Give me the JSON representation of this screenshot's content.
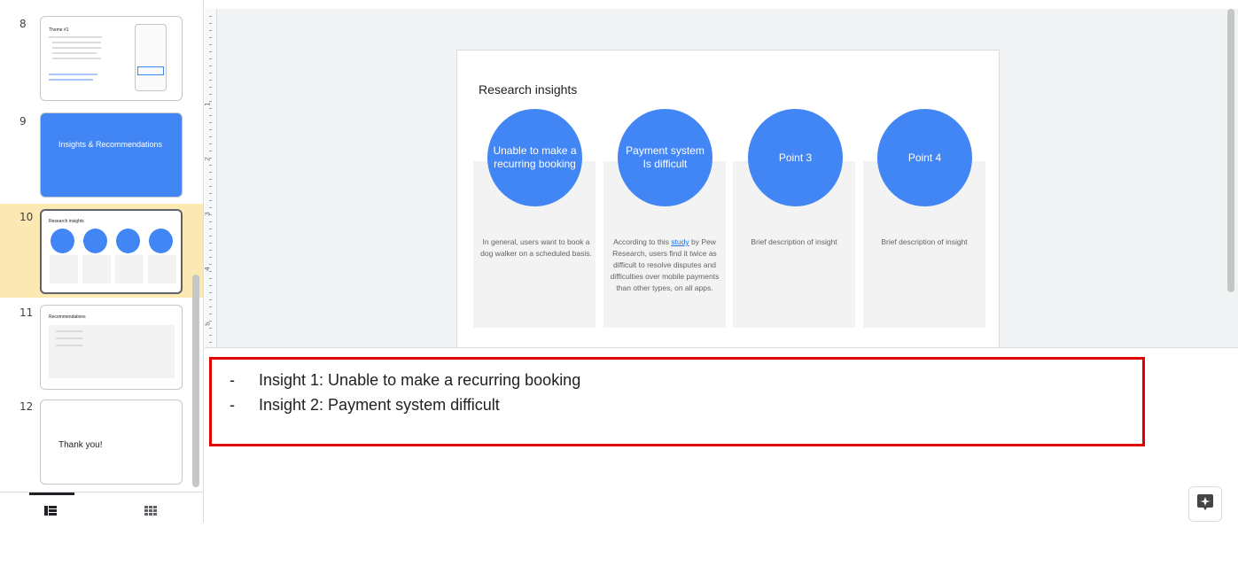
{
  "filmstrip": {
    "slides": [
      {
        "num": "8",
        "title": "Theme #1"
      },
      {
        "num": "9",
        "title": "Insights & Recommendations"
      },
      {
        "num": "10",
        "title": "Research insights"
      },
      {
        "num": "11",
        "title": "Recommendations"
      },
      {
        "num": "12",
        "title": "Thank you!"
      }
    ],
    "selected": "10"
  },
  "view_toggle": {
    "filmstrip_icon": "filmstrip-view-icon",
    "grid_icon": "grid-view-icon"
  },
  "ruler": {
    "numbers": [
      "1",
      "2",
      "3",
      "4",
      "5"
    ]
  },
  "slide": {
    "title": "Research insights",
    "cards": [
      {
        "circle": "Unable to make a recurring booking",
        "desc": "In general, users want to book a dog walker on a scheduled basis."
      },
      {
        "circle": "Payment system Is difficult",
        "desc_before": "According to this ",
        "desc_link": "study",
        "desc_after": " by Pew Research, users find it twice as difficult to resolve disputes and difficulties over mobile payments than other types, on all apps."
      },
      {
        "circle": "Point 3",
        "desc": "Brief description of insight"
      },
      {
        "circle": "Point 4",
        "desc": "Brief description of insight"
      }
    ]
  },
  "notes": {
    "lines": [
      {
        "bullet": "-",
        "text": "Insight 1: Unable to make a recurring booking"
      },
      {
        "bullet": "-",
        "text": "Insight 2: Payment system difficult"
      }
    ]
  },
  "colors": {
    "accent": "#4285f4",
    "highlight": "#fce8b2",
    "annotation": "#e00000"
  }
}
